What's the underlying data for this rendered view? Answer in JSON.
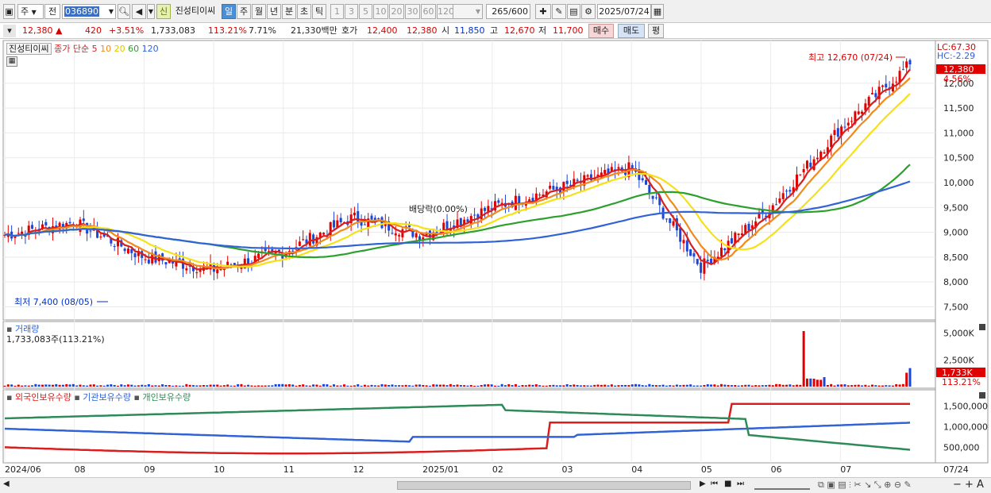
{
  "toolbar": {
    "market": "주",
    "period_mode": "전",
    "code": "036890",
    "badge": "신",
    "stock_name": "진성티이씨",
    "periods": [
      "일",
      "주",
      "월",
      "년",
      "분",
      "초",
      "틱"
    ],
    "active_period": "일",
    "intervals": [
      "1",
      "3",
      "5",
      "10",
      "20",
      "30",
      "60",
      "120"
    ],
    "count": "265",
    "count_max": "/600",
    "date": "2025/07/24"
  },
  "quote": {
    "price": "12,380",
    "change": "420",
    "change_pct": "+3.51%",
    "volume": "1,733,083",
    "volume_ratio": "113.21%",
    "turnover": "7.71%",
    "amount": "21,330백만",
    "ask_label": "호가",
    "ask": "12,400",
    "bid": "12,380",
    "open_label": "시",
    "open": "11,850",
    "high_label": "고",
    "high": "12,670",
    "low_label": "저",
    "low": "11,700",
    "buy_label": "매수",
    "sell_label": "매도",
    "eval_label": "평"
  },
  "price_panel": {
    "legend_name": "진성티이씨",
    "legend_ma_label": "종가 단순",
    "ma_periods": [
      "5",
      "10",
      "20",
      "60",
      "120"
    ],
    "ma_colors": [
      "#d81e1e",
      "#f08a1d",
      "#f5e116",
      "#2ca02c",
      "#3263d6"
    ],
    "y_labels": [
      "12,000",
      "11,500",
      "11,000",
      "10,500",
      "10,000",
      "9,500",
      "9,000",
      "8,500",
      "8,000",
      "7,500"
    ],
    "lc_label": "LC:67.30",
    "hc_label": "HC:-2.29",
    "current_price_tag": "12,380",
    "current_pct_tag": "4.56%",
    "high_annotation": "최고 12,670 (07/24)",
    "low_annotation": "최저 7,400 (08/05)",
    "event_annotation": "배당락(0.00%)"
  },
  "volume_panel": {
    "title": "거래량",
    "value_label": "1,733,083주(113.21%)",
    "y_labels": [
      "5,000K",
      "2,500K"
    ],
    "current_tag": "1,733K",
    "current_pct_tag": "113.21%"
  },
  "holding_panel": {
    "legend": [
      "외국인보유수량",
      "기관보유수량",
      "개인보유수량"
    ],
    "legend_colors": [
      "#d81e1e",
      "#3263d6",
      "#2e8b57"
    ],
    "y_labels": [
      "1,500,000",
      "1,000,000",
      "500,000"
    ]
  },
  "x_axis": {
    "labels": [
      "2024/06",
      "08",
      "09",
      "10",
      "11",
      "12",
      "2025/01",
      "02",
      "03",
      "04",
      "05",
      "06",
      "07"
    ],
    "last_label": "07/24"
  },
  "chart_data": {
    "type": "candlestick",
    "price_range": [
      7300,
      12700
    ],
    "monthly_anchor_close": [
      [
        "2024/06",
        8950
      ],
      [
        "07",
        9200
      ],
      [
        "08",
        8500
      ],
      [
        "09",
        8250
      ],
      [
        "10",
        8600
      ],
      [
        "11",
        9300
      ],
      [
        "12",
        8950
      ],
      [
        "2025/01",
        9500
      ],
      [
        "02",
        9900
      ],
      [
        "03",
        10300
      ],
      [
        "04",
        8300
      ],
      [
        "05",
        9500
      ],
      [
        "06",
        11100
      ],
      [
        "07",
        12380
      ]
    ],
    "high": 12670,
    "high_date": "07/24",
    "low": 7400,
    "low_date": "08/05",
    "volume_range_k": [
      0,
      5500
    ],
    "holding_range": [
      200000,
      1700000
    ]
  }
}
